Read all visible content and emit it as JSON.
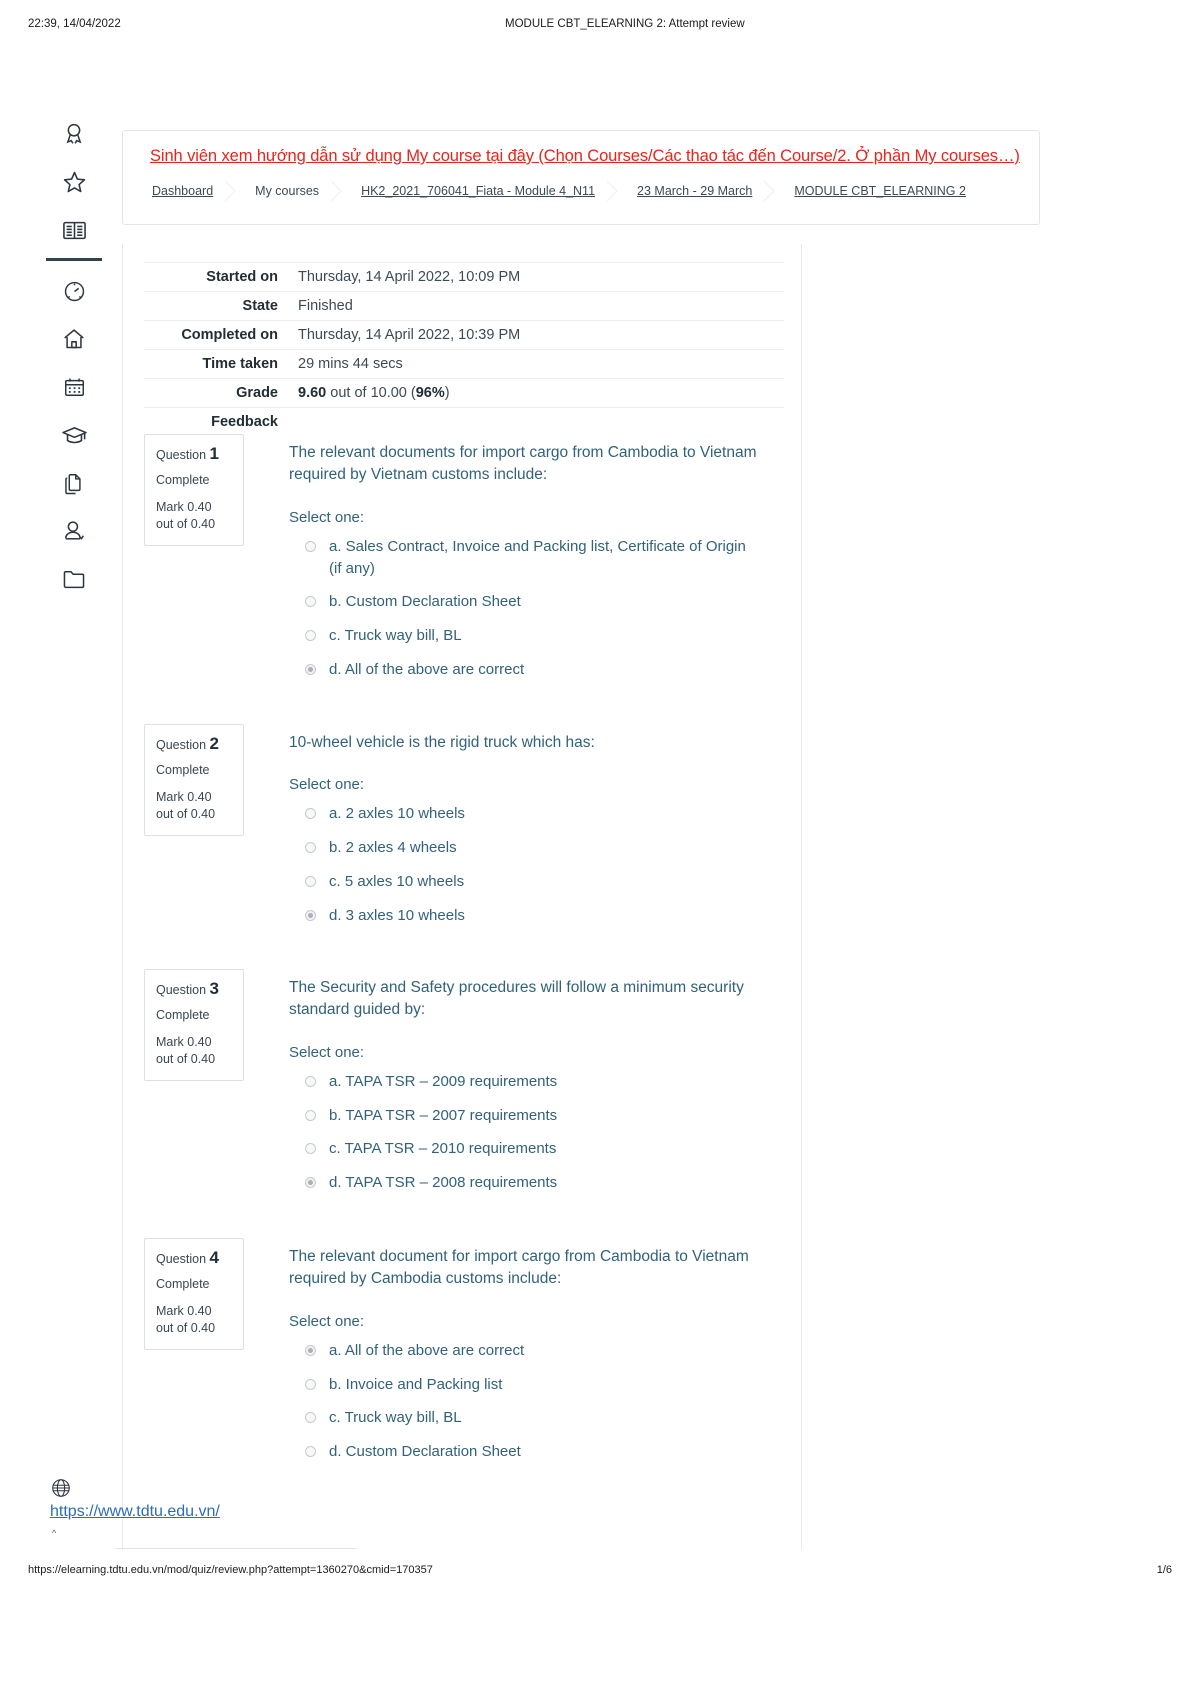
{
  "print_header": {
    "timestamp": "22:39, 14/04/2022",
    "title": "MODULE CBT_ELEARNING 2: Attempt review"
  },
  "sidebar": {
    "items": [
      {
        "icon": "award-badge-icon",
        "label": "Badges"
      },
      {
        "icon": "star-icon",
        "label": "Starred"
      },
      {
        "icon": "open-book-icon",
        "label": "Courses"
      },
      {
        "icon": "speedometer-icon",
        "label": "Dashboard"
      },
      {
        "icon": "home-icon",
        "label": "Site home"
      },
      {
        "icon": "calendar-icon",
        "label": "Calendar"
      },
      {
        "icon": "graduation-cap-icon",
        "label": "Grades"
      },
      {
        "icon": "documents-icon",
        "label": "Files"
      },
      {
        "icon": "user-check-icon",
        "label": "Profile"
      },
      {
        "icon": "folder-icon",
        "label": "Private files"
      }
    ]
  },
  "banner": {
    "notice_link": "Sinh viên xem hướng dẫn sử dụng My course tại đây (Chọn Courses/Các thao tác đến Course/2. Ở phần My courses…)",
    "breadcrumbs": [
      {
        "label": "Dashboard",
        "link": true
      },
      {
        "label": "My courses",
        "link": false
      },
      {
        "label": "HK2_2021_706041_Fiata - Module 4_N11",
        "link": true
      },
      {
        "label": "23 March - 29 March",
        "link": true
      },
      {
        "label": "MODULE CBT_ELEARNING 2",
        "link": true
      }
    ]
  },
  "summary": {
    "rows": [
      {
        "label": "Started on",
        "value": "Thursday, 14 April 2022, 10:09 PM"
      },
      {
        "label": "State",
        "value": "Finished"
      },
      {
        "label": "Completed on",
        "value": "Thursday, 14 April 2022, 10:39 PM"
      },
      {
        "label": "Time taken",
        "value": "29 mins 44 secs"
      }
    ],
    "grade_label": "Grade",
    "grade_value": "9.60",
    "grade_middle": " out of 10.00 (",
    "grade_percent": "96%",
    "grade_close": ")",
    "feedback_label": "Feedback"
  },
  "questions": [
    {
      "num_label": "Question",
      "num": "1",
      "state": "Complete",
      "mark": "Mark 0.40 out of 0.40",
      "text": "The relevant documents for import cargo from Cambodia to Vietnam required by Vietnam customs include:",
      "select_label": "Select one:",
      "options": [
        {
          "label": "a. Sales Contract, Invoice and Packing list, Certificate of Origin (if any)",
          "checked": false
        },
        {
          "label": "b. Custom Declaration Sheet",
          "checked": false
        },
        {
          "label": "c. Truck way bill, BL",
          "checked": false
        },
        {
          "label": "d. All of the above are correct",
          "checked": true
        }
      ]
    },
    {
      "num_label": "Question",
      "num": "2",
      "state": "Complete",
      "mark": "Mark 0.40 out of 0.40",
      "text": "10-wheel vehicle is the rigid truck which has:",
      "select_label": "Select one:",
      "options": [
        {
          "label": "a. 2 axles 10 wheels",
          "checked": false
        },
        {
          "label": "b. 2 axles 4 wheels",
          "checked": false
        },
        {
          "label": "c. 5 axles 10 wheels",
          "checked": false
        },
        {
          "label": "d. 3 axles 10 wheels",
          "checked": true
        }
      ]
    },
    {
      "num_label": "Question",
      "num": "3",
      "state": "Complete",
      "mark": "Mark 0.40 out of 0.40",
      "text": "The Security and Safety procedures will follow a minimum security standard guided by:",
      "select_label": "Select one:",
      "options": [
        {
          "label": "a. TAPA TSR – 2009 requirements",
          "checked": false
        },
        {
          "label": "b. TAPA TSR – 2007 requirements",
          "checked": false
        },
        {
          "label": "c. TAPA TSR – 2010 requirements",
          "checked": false
        },
        {
          "label": "d. TAPA TSR – 2008 requirements",
          "checked": true
        }
      ]
    },
    {
      "num_label": "Question",
      "num": "4",
      "state": "Complete",
      "mark": "Mark 0.40 out of 0.40",
      "text": "The relevant document for import cargo from Cambodia to Vietnam required by Cambodia customs include:",
      "select_label": "Select one:",
      "options": [
        {
          "label": "a. All of the above are correct",
          "checked": true
        },
        {
          "label": "b. Invoice and Packing list",
          "checked": false
        },
        {
          "label": "c. Truck way bill, BL",
          "checked": false
        },
        {
          "label": "d. Custom Declaration Sheet",
          "checked": false
        }
      ]
    }
  ],
  "site": {
    "url": "https://www.tdtu.edu.vn/",
    "caret": "^"
  },
  "print_footer": {
    "url": "https://elearning.tdtu.edu.vn/mod/quiz/review.php?attempt=1360270&cmid=170357",
    "page": "1/6"
  },
  "colors": {
    "notice_red": "#e8241c",
    "question_blue": "#31627a",
    "link_blue": "#2a6ebb"
  }
}
